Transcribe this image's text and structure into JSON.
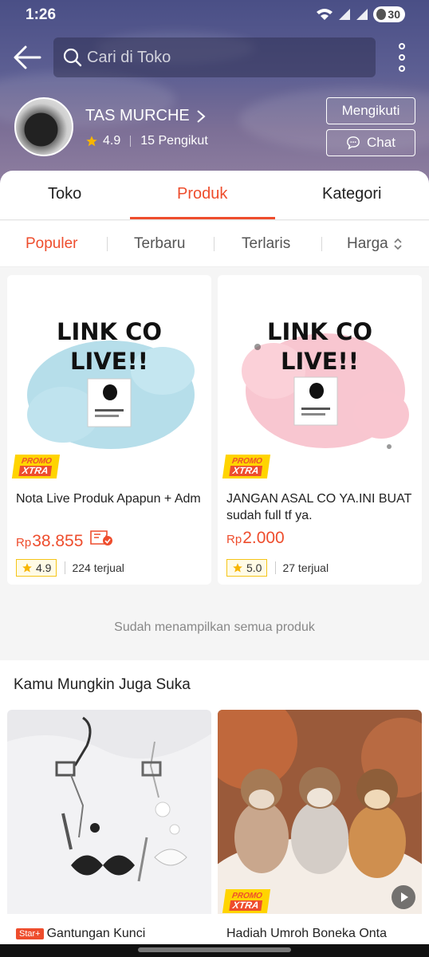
{
  "status": {
    "time": "1:26",
    "battery": "30"
  },
  "search": {
    "placeholder": "Cari di Toko"
  },
  "shop": {
    "name": "TAS MURCHE",
    "rating": "4.9",
    "followers": "15 Pengikut",
    "follow_label": "Mengikuti",
    "chat_label": "Chat"
  },
  "tabs": [
    {
      "label": "Toko"
    },
    {
      "label": "Produk"
    },
    {
      "label": "Kategori"
    }
  ],
  "sort": [
    {
      "label": "Populer"
    },
    {
      "label": "Terbaru"
    },
    {
      "label": "Terlaris"
    },
    {
      "label": "Harga"
    }
  ],
  "products": [
    {
      "image_text_1": "LINK CO",
      "image_text_2": "LIVE!!",
      "promo_top": "PROMO",
      "promo_bottom": "XTRA",
      "title": "Nota Live Produk Apapun + Adm",
      "currency": "Rp",
      "price": "38.855",
      "rating": "4.9",
      "sold": "224 terjual",
      "color": "#a9d8e6"
    },
    {
      "image_text_1": "LINK CO",
      "image_text_2": "LIVE!!",
      "promo_top": "PROMO",
      "promo_bottom": "XTRA",
      "title": "JANGAN ASAL CO YA.INI BUAT sudah full tf ya.",
      "currency": "Rp",
      "price": "2.000",
      "rating": "5.0",
      "sold": "27 terjual",
      "color": "#f7bcc8"
    }
  ],
  "end_note": "Sudah menampilkan semua produk",
  "recommend": {
    "title": "Kamu Mungkin Juga Suka",
    "items": [
      {
        "badge": "Star+",
        "label": "Gantungan Kunci"
      },
      {
        "promo_top": "PROMO",
        "promo_bottom": "XTRA",
        "label": "Hadiah Umroh Boneka Onta"
      }
    ]
  },
  "accent_color": "#ee4d2d"
}
